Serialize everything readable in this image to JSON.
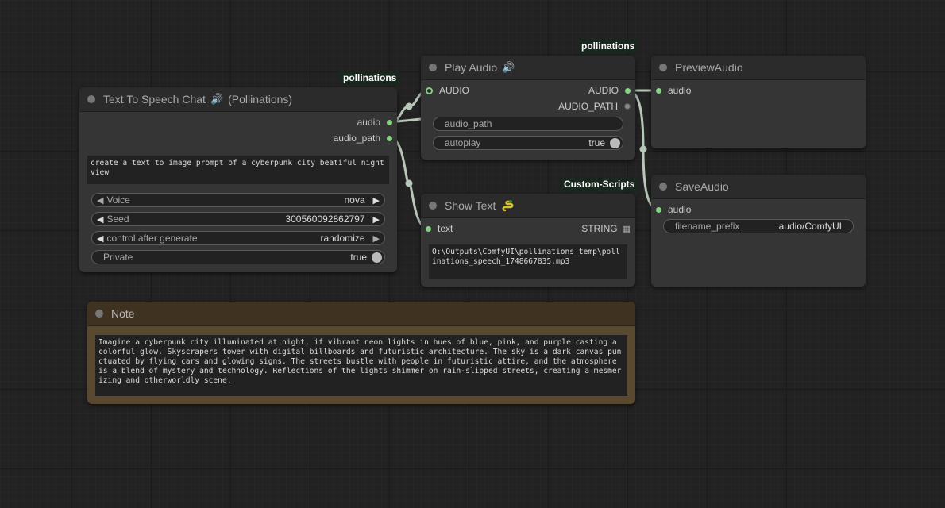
{
  "colors": {
    "canvas": "#222222",
    "node_body": "#353535",
    "node_title": "#2b2b2b",
    "note_body": "#594a2f",
    "note_title": "#3f3220",
    "socket_green": "#7fd67f",
    "link": "#b8c8b8",
    "badge_bg": "#18281e"
  },
  "tts_node": {
    "badge": "pollinations",
    "title_prefix": "Text To Speech Chat",
    "title_suffix": "(Pollinations)",
    "title_icon": "speaker-icon",
    "outputs": [
      "audio",
      "audio_path"
    ],
    "prompt": "create a text to image prompt of a cyberpunk city beatiful night view",
    "widgets": {
      "voice_label": "Voice",
      "voice_value": "nova",
      "seed_label": "Seed",
      "seed_value": "300560092862797",
      "control_label": "control after generate",
      "control_value": "randomize",
      "private_label": "Private",
      "private_value": "true"
    }
  },
  "play_audio": {
    "badge": "pollinations",
    "title": "Play Audio",
    "title_icon": "speaker-icon",
    "input": "AUDIO",
    "outputs": [
      "AUDIO",
      "AUDIO_PATH"
    ],
    "widget_audio_path": "audio_path",
    "autoplay_label": "autoplay",
    "autoplay_value": "true"
  },
  "preview_audio": {
    "title": "PreviewAudio",
    "input": "audio"
  },
  "save_audio": {
    "title": "SaveAudio",
    "input": "audio",
    "prefix_label": "filename_prefix",
    "prefix_value": "audio/ComfyUI"
  },
  "show_text": {
    "badge": "Custom-Scripts",
    "title": "Show Text",
    "title_icon": "snake-icon",
    "input": "text",
    "output": "STRING",
    "content": "O:\\Outputs\\ComfyUI\\pollinations_temp\\pollinations_speech_1748667835.mp3"
  },
  "note": {
    "title": "Note",
    "content": "Imagine a cyberpunk city illuminated at night, if vibrant neon lights in hues of blue, pink, and purple casting a colorful glow. Skyscrapers tower with digital billboards and futuristic architecture. The sky is a dark canvas punctuated by flying cars and glowing signs. The streets bustle with people in futuristic attire, and the atmosphere is a blend of mystery and technology. Reflections of the lights shimmer on rain-slipped streets, creating a mesmerizing and otherworldly scene."
  }
}
